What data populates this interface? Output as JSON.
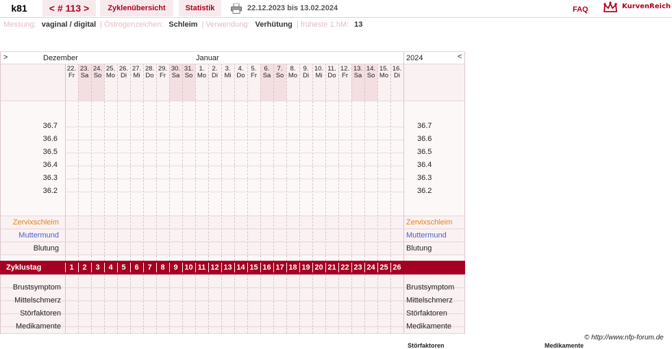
{
  "header": {
    "username": "k81",
    "cycle_nav": "< # 113 >",
    "tab_zyklen": "Zyklenübersicht",
    "tab_statistik": "Statistik",
    "date_range": "22.12.2023 bis 13.02.2024",
    "faq": "FAQ",
    "logo_text": "KurvenReich"
  },
  "info": {
    "messung_label": "Messung:",
    "messung_value": "vaginal / digital",
    "oestrogen_label": "Östrogenzeichen:",
    "oestrogen_value": "Schleim",
    "verwendung_label": "Verwendung:",
    "verwendung_value": "Verhütung",
    "hm_label": "früheste 1.hM:",
    "hm_value": "13",
    "separator": "|"
  },
  "chart": {
    "nav_left": ">",
    "nav_right": "<",
    "month_left": "Dezember",
    "month_mid": "Januar",
    "year": "2024",
    "days": [
      {
        "num": "22.",
        "wd": "Fr",
        "we": false
      },
      {
        "num": "23.",
        "wd": "Sa",
        "we": true
      },
      {
        "num": "24.",
        "wd": "So",
        "we": true
      },
      {
        "num": "25.",
        "wd": "Mo",
        "we": false
      },
      {
        "num": "26.",
        "wd": "Di",
        "we": false
      },
      {
        "num": "27.",
        "wd": "Mi",
        "we": false
      },
      {
        "num": "28.",
        "wd": "Do",
        "we": false
      },
      {
        "num": "29.",
        "wd": "Fr",
        "we": false
      },
      {
        "num": "30.",
        "wd": "Sa",
        "we": true
      },
      {
        "num": "31.",
        "wd": "So",
        "we": true
      },
      {
        "num": "1.",
        "wd": "Mo",
        "we": false
      },
      {
        "num": "2.",
        "wd": "Di",
        "we": false
      },
      {
        "num": "3.",
        "wd": "Mi",
        "we": false
      },
      {
        "num": "4.",
        "wd": "Do",
        "we": false
      },
      {
        "num": "5.",
        "wd": "Fr",
        "we": false
      },
      {
        "num": "6.",
        "wd": "Sa",
        "we": true
      },
      {
        "num": "7.",
        "wd": "So",
        "we": true
      },
      {
        "num": "8.",
        "wd": "Mo",
        "we": false
      },
      {
        "num": "9.",
        "wd": "Di",
        "we": false
      },
      {
        "num": "10.",
        "wd": "Mi",
        "we": false
      },
      {
        "num": "11.",
        "wd": "Do",
        "we": false
      },
      {
        "num": "12.",
        "wd": "Fr",
        "we": false
      },
      {
        "num": "13.",
        "wd": "Sa",
        "we": true
      },
      {
        "num": "14.",
        "wd": "So",
        "we": true
      },
      {
        "num": "15.",
        "wd": "Mo",
        "we": false
      },
      {
        "num": "16.",
        "wd": "Di",
        "we": false
      }
    ],
    "temps": [
      "36.7",
      "36.6",
      "36.5",
      "36.4",
      "36.3",
      "36.2"
    ],
    "rows_upper": [
      {
        "label": "Zervixschleim",
        "color": "#e8811a"
      },
      {
        "label": "Muttermund",
        "color": "#4a5fc8"
      },
      {
        "label": "Blutung",
        "color": "#222222"
      }
    ],
    "zyklustag_label": "Zyklustag",
    "cycle_days": [
      "1",
      "2",
      "3",
      "4",
      "5",
      "6",
      "7",
      "8",
      "9",
      "10",
      "11",
      "12",
      "13",
      "14",
      "15",
      "16",
      "17",
      "18",
      "19",
      "20",
      "21",
      "22",
      "23",
      "24",
      "25",
      "26"
    ],
    "rows_lower": [
      "Brustsymptom",
      "Mittelschmerz",
      "Störfaktoren",
      "Medikamente"
    ]
  },
  "footer": {
    "credit": "© http://www.nfp-forum.de",
    "below1": "Störfaktoren",
    "below2": "Medikamente"
  }
}
